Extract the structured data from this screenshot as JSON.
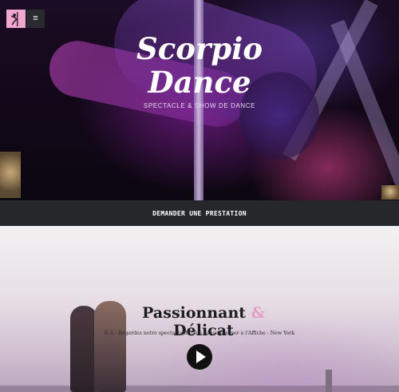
{
  "header": {
    "logo_icon": "pole-dancer-icon",
    "menu_icon": "hamburger-menu-icon",
    "menu_glyph": "≡",
    "accent_color": "#f2a7cf"
  },
  "hero": {
    "title_line1": "Scorpio",
    "title_line2": "Dance",
    "subtitle": "SPECTACLE & SHOW DE DANCE"
  },
  "cta": {
    "label": "DEMANDER UNE PRESTATION",
    "bar_color": "#26272b"
  },
  "video_section": {
    "title_word1": "Passionnant",
    "title_amp": "&",
    "title_word2": "Délicat",
    "caption": "B-A - Regardez notre spectacle de pole danse réaliser à l'Affiche - New York",
    "play_icon": "play-icon"
  }
}
